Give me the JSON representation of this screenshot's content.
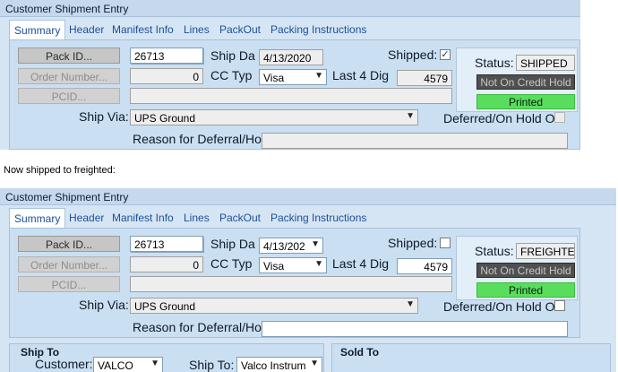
{
  "screen1": {
    "title": "Customer Shipment Entry",
    "tabs": [
      "Summary",
      "Header",
      "Manifest Info",
      "Lines",
      "PackOut",
      "Packing Instructions"
    ],
    "pack_id_label": "Pack ID...",
    "pack_id_value": "26713",
    "order_number_label": "Order Number...",
    "order_number_value": "0",
    "pcid_label": "PCID...",
    "pcid_value": "",
    "ship_date_label": "Ship Da",
    "ship_date_value": "4/13/2020",
    "cc_type_label": "CC Typ",
    "cc_type_value": "Visa",
    "last4_label": "Last 4 Dig",
    "last4_value": "4579",
    "shipped_label": "Shipped:",
    "shipped_checked": true,
    "shipped_mark": "✓",
    "status_label": "Status:",
    "status_value": "SHIPPED",
    "credit_hold": "Not On Credit Hold",
    "printed": "Printed",
    "ship_via_label": "Ship Via:",
    "ship_via_value": "UPS Ground",
    "deferred_label": "Deferred/On Hold O",
    "reason_label": "Reason for Deferral/Hol",
    "reason_value": ""
  },
  "note": "Now shipped to freighted:",
  "screen2": {
    "title": "Customer Shipment Entry",
    "tabs": [
      "Summary",
      "Header",
      "Manifest Info",
      "Lines",
      "PackOut",
      "Packing Instructions"
    ],
    "pack_id_label": "Pack ID...",
    "pack_id_value": "26713",
    "order_number_label": "Order Number...",
    "order_number_value": "0",
    "pcid_label": "PCID...",
    "pcid_value": "",
    "ship_date_label": "Ship Da",
    "ship_date_value": "4/13/202",
    "cc_type_label": "CC Typ",
    "cc_type_value": "Visa",
    "last4_label": "Last 4 Dig",
    "last4_value": "4579",
    "shipped_label": "Shipped:",
    "shipped_checked": false,
    "status_label": "Status:",
    "status_value": "FREIGHTE",
    "credit_hold": "Not On Credit Hold",
    "printed": "Printed",
    "ship_via_label": "Ship Via:",
    "ship_via_value": "UPS Ground",
    "deferred_label": "Deferred/On Hold O",
    "reason_label": "Reason for Deferral/Hol",
    "reason_value": "",
    "ship_to_title": "Ship To",
    "customer_label": "Customer:",
    "customer_value": "VALCO",
    "ship_to_label": "Ship To:",
    "ship_to_value": "Valco Instrum",
    "sold_to_title": "Sold To"
  },
  "colors": {
    "panel_bg": "#d6e5f4",
    "tab_text": "#1b4f9a",
    "credit_hold_bg": "#505050",
    "printed_bg": "#59dd5d"
  },
  "icons": {
    "dropdown": "chevron-down-icon",
    "checkbox": "checkbox-icon"
  }
}
